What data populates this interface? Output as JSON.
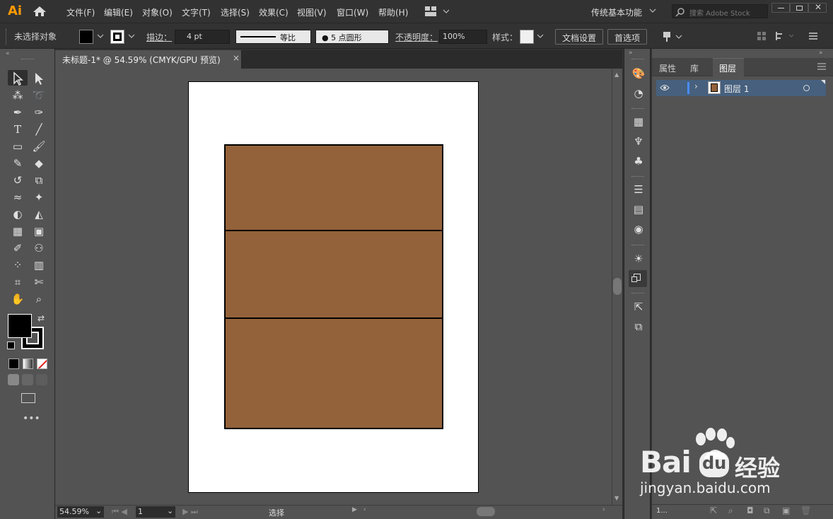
{
  "app": {
    "logo": "Ai"
  },
  "menu": {
    "items": [
      "文件(F)",
      "编辑(E)",
      "对象(O)",
      "文字(T)",
      "选择(S)",
      "效果(C)",
      "视图(V)",
      "窗口(W)",
      "帮助(H)"
    ],
    "workspace": "传统基本功能",
    "search_placeholder": "搜索 Adobe Stock"
  },
  "control": {
    "selection": "未选择对象",
    "stroke_label": "描边：",
    "stroke_value": "4 pt",
    "profile_label": "等比",
    "brush_label": "5 点圆形",
    "opacity_label": "不透明度：",
    "opacity_value": "100%",
    "style_label": "样式：",
    "doc_setup": "文档设置",
    "prefs": "首选项"
  },
  "document": {
    "tab_title": "未标题-1* @ 54.59% (CMYK/GPU 预览)",
    "fill_color": "#93623a"
  },
  "status": {
    "zoom": "54.59%",
    "page": "1",
    "tool": "选择"
  },
  "panel": {
    "tabs": [
      "属性",
      "库",
      "图层"
    ],
    "layer_name": "图层 1",
    "footer_count": "1..."
  },
  "watermark": {
    "brand": "Bai",
    "brand_tail": "经验",
    "url": "jingyan.baidu.com"
  }
}
